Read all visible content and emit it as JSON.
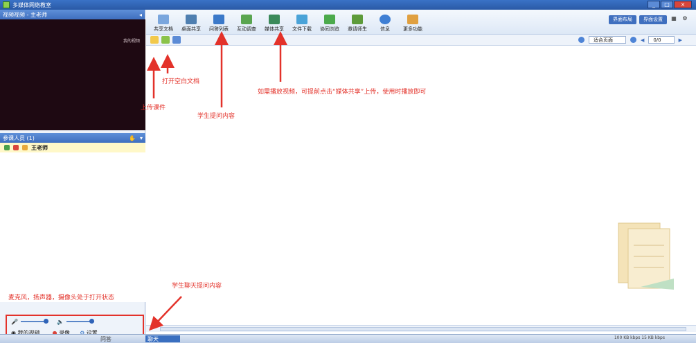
{
  "window": {
    "title": "多媒体网络教室",
    "controls": [
      "_",
      "□",
      "×"
    ]
  },
  "video_panel": {
    "header": "视频视频 - 主老师",
    "overlay_label": "我的视频"
  },
  "users_panel": {
    "header": "参课人员 (1)",
    "users": [
      {
        "name": "王老师"
      }
    ]
  },
  "toolbar": {
    "items": [
      {
        "label": "共享文档",
        "icon": "document-icon",
        "color": "#7aa6dd"
      },
      {
        "label": "桌面共享",
        "icon": "desktop-share-icon",
        "color": "#4f7fb0"
      },
      {
        "label": "问答列表",
        "icon": "qa-list-icon",
        "color": "#3b79c9"
      },
      {
        "label": "互动调查",
        "icon": "survey-icon",
        "color": "#5aa550"
      },
      {
        "label": "媒体共享",
        "icon": "media-share-icon",
        "color": "#3b8a5a"
      },
      {
        "label": "文件下载",
        "icon": "file-download-icon",
        "color": "#4aa3d8"
      },
      {
        "label": "协同浏览",
        "icon": "co-browse-icon",
        "color": "#4caa4c"
      },
      {
        "label": "邀请师生",
        "icon": "invite-icon",
        "color": "#5d9b3a"
      },
      {
        "label": "信息",
        "icon": "info-icon",
        "color": "#3f7fd4"
      },
      {
        "label": "更多功能",
        "icon": "more-icon",
        "color": "#e0a040"
      }
    ],
    "right_buttons": [
      "界面布局",
      "界面设置"
    ]
  },
  "subbar": {
    "page_mode": "适合页面",
    "page_number": "0/0"
  },
  "annotations": {
    "open_blank": "打开空白文档",
    "upload": "上传课件",
    "student_question": "学生提问内容",
    "media_tip": "如需播放视频，可提前点击“媒体共享”上传，使用时播放即可",
    "student_chat": "学生聊天提问内容",
    "devices_on": "麦克风，扬声器，摄像头处于打开状态"
  },
  "controls": {
    "mic_label": "",
    "speaker_label": "",
    "my_video": "我的视频",
    "record": "录像",
    "settings": "设置"
  },
  "taskbar": {
    "item_a": "问答",
    "item_b": "聊天",
    "status": "100 KB kbps  15 KB kbps"
  }
}
